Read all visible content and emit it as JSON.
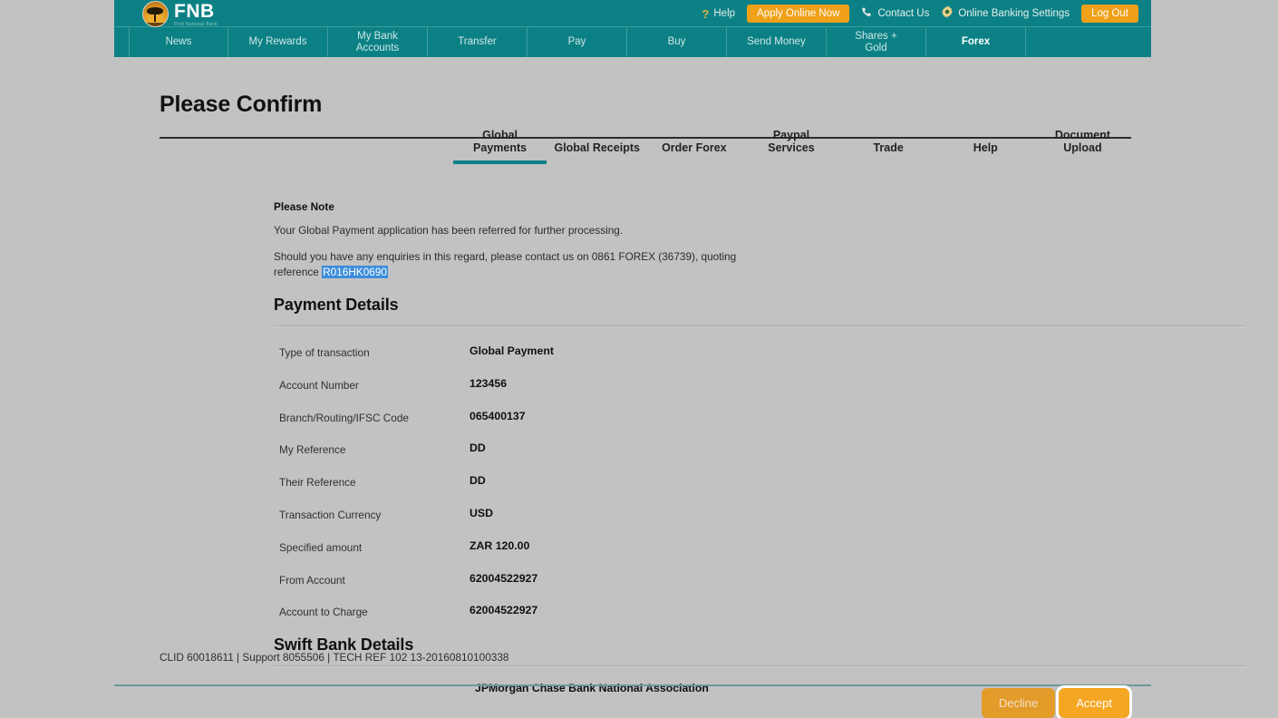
{
  "brand": {
    "name": "FNB",
    "tagline": "First National Bank",
    "logo_icon": "acacia-tree-circle-icon"
  },
  "theme": {
    "teal": "#0c8185",
    "orange": "#f0a019",
    "page_background": "#c2c2c2",
    "selection_blue": "#3c8ddc"
  },
  "utility_bar": {
    "help": {
      "label": "Help",
      "icon": "question-mark-icon"
    },
    "apply_online": {
      "label": "Apply Online Now"
    },
    "contact_us": {
      "label": "Contact Us",
      "icon": "phone-icon"
    },
    "settings": {
      "label": "Online Banking Settings",
      "icon": "gear-icon"
    },
    "log_out": {
      "label": "Log Out"
    }
  },
  "main_nav": [
    {
      "label": "News",
      "active": false
    },
    {
      "label": "My Rewards",
      "active": false
    },
    {
      "label": "My Bank\nAccounts",
      "active": false
    },
    {
      "label": "Transfer",
      "active": false
    },
    {
      "label": "Pay",
      "active": false
    },
    {
      "label": "Buy",
      "active": false
    },
    {
      "label": "Send Money",
      "active": false
    },
    {
      "label": "Shares +\nGold",
      "active": false
    },
    {
      "label": "Forex",
      "active": true
    }
  ],
  "page": {
    "title": "Please Confirm"
  },
  "subtabs": [
    {
      "label": "Global\nPayments",
      "active": true
    },
    {
      "label": "Global Receipts",
      "active": false
    },
    {
      "label": "Order Forex",
      "active": false
    },
    {
      "label": "Paypal\nServices",
      "active": false
    },
    {
      "label": "Trade",
      "active": false
    },
    {
      "label": "Help",
      "active": false
    },
    {
      "label": "Document\nUpload",
      "active": false
    }
  ],
  "note": {
    "heading": "Please Note",
    "line_1": "Your Global Payment application has been referred for further processing.",
    "line_2_prefix": "Should you have any enquiries in this regard, please contact us on 0861 FOREX (36739), quoting reference ",
    "reference": "R016HK0690"
  },
  "payment_details": {
    "title": "Payment Details",
    "rows": [
      {
        "label": "Type of transaction",
        "value": "Global Payment"
      },
      {
        "label": "Account Number",
        "value": "123456"
      },
      {
        "label": "Branch/Routing/IFSC Code",
        "value": "065400137"
      },
      {
        "label": "My Reference",
        "value": "DD"
      },
      {
        "label": "Their Reference",
        "value": "DD"
      },
      {
        "label": "Transaction Currency",
        "value": "USD"
      },
      {
        "label": "Specified amount",
        "value": "ZAR 120.00"
      },
      {
        "label": "From Account",
        "value": "62004522927"
      },
      {
        "label": "Account to Charge",
        "value": "62004522927"
      }
    ]
  },
  "swift_details": {
    "title": "Swift Bank Details",
    "rows": [
      {
        "value": "JPMorgan Chase Bank National Association"
      }
    ]
  },
  "footer": {
    "text": "CLID 60018611 | Support 8055506 | TECH REF 102 13-20160810100338"
  },
  "actions": {
    "decline_label": "Decline",
    "accept_label": "Accept"
  }
}
